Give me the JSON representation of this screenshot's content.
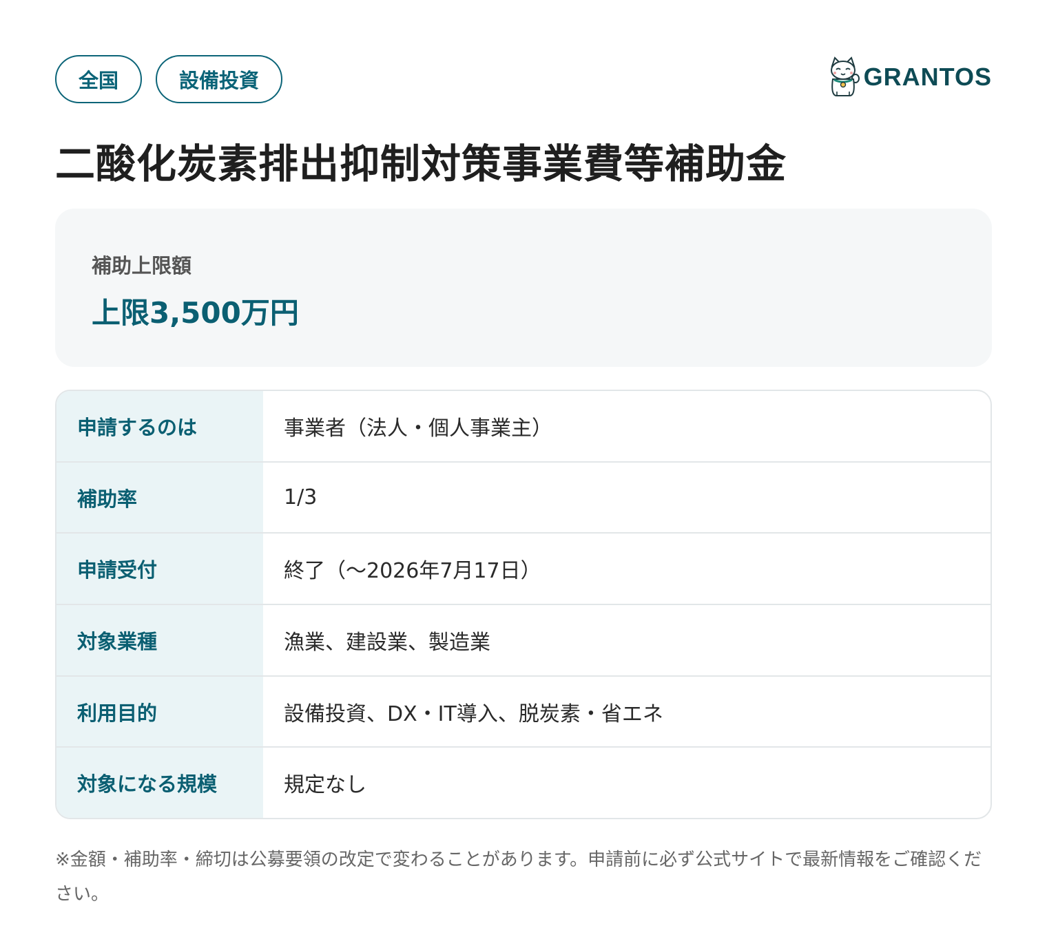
{
  "tags": [
    "全国",
    "設備投資"
  ],
  "logo": {
    "text": "GRANTOS",
    "icon": "maneki-neko-icon"
  },
  "title": "二酸化炭素排出抑制対策事業費等補助金",
  "amount": {
    "label": "補助上限額",
    "value": "上限3,500万円"
  },
  "info_rows": [
    {
      "label": "申請するのは",
      "value": "事業者（法人・個人事業主）"
    },
    {
      "label": "補助率",
      "value": "1/3"
    },
    {
      "label": "申請受付",
      "value": "終了（〜2026年7月17日）"
    },
    {
      "label": "対象業種",
      "value": "漁業、建設業、製造業"
    },
    {
      "label": "利用目的",
      "value": "設備投資、DX・IT導入、脱炭素・省エネ"
    },
    {
      "label": "対象になる規模",
      "value": "規定なし"
    }
  ],
  "note": "※金額・補助率・締切は公募要領の改定で変わることがあります。申請前に必ず公式サイトで最新情報をご確認ください。",
  "colors": {
    "accent": "#0b5f72",
    "label_bg": "#eaf4f6",
    "card_bg": "#f5f7f8",
    "border": "#e2e6e8"
  }
}
